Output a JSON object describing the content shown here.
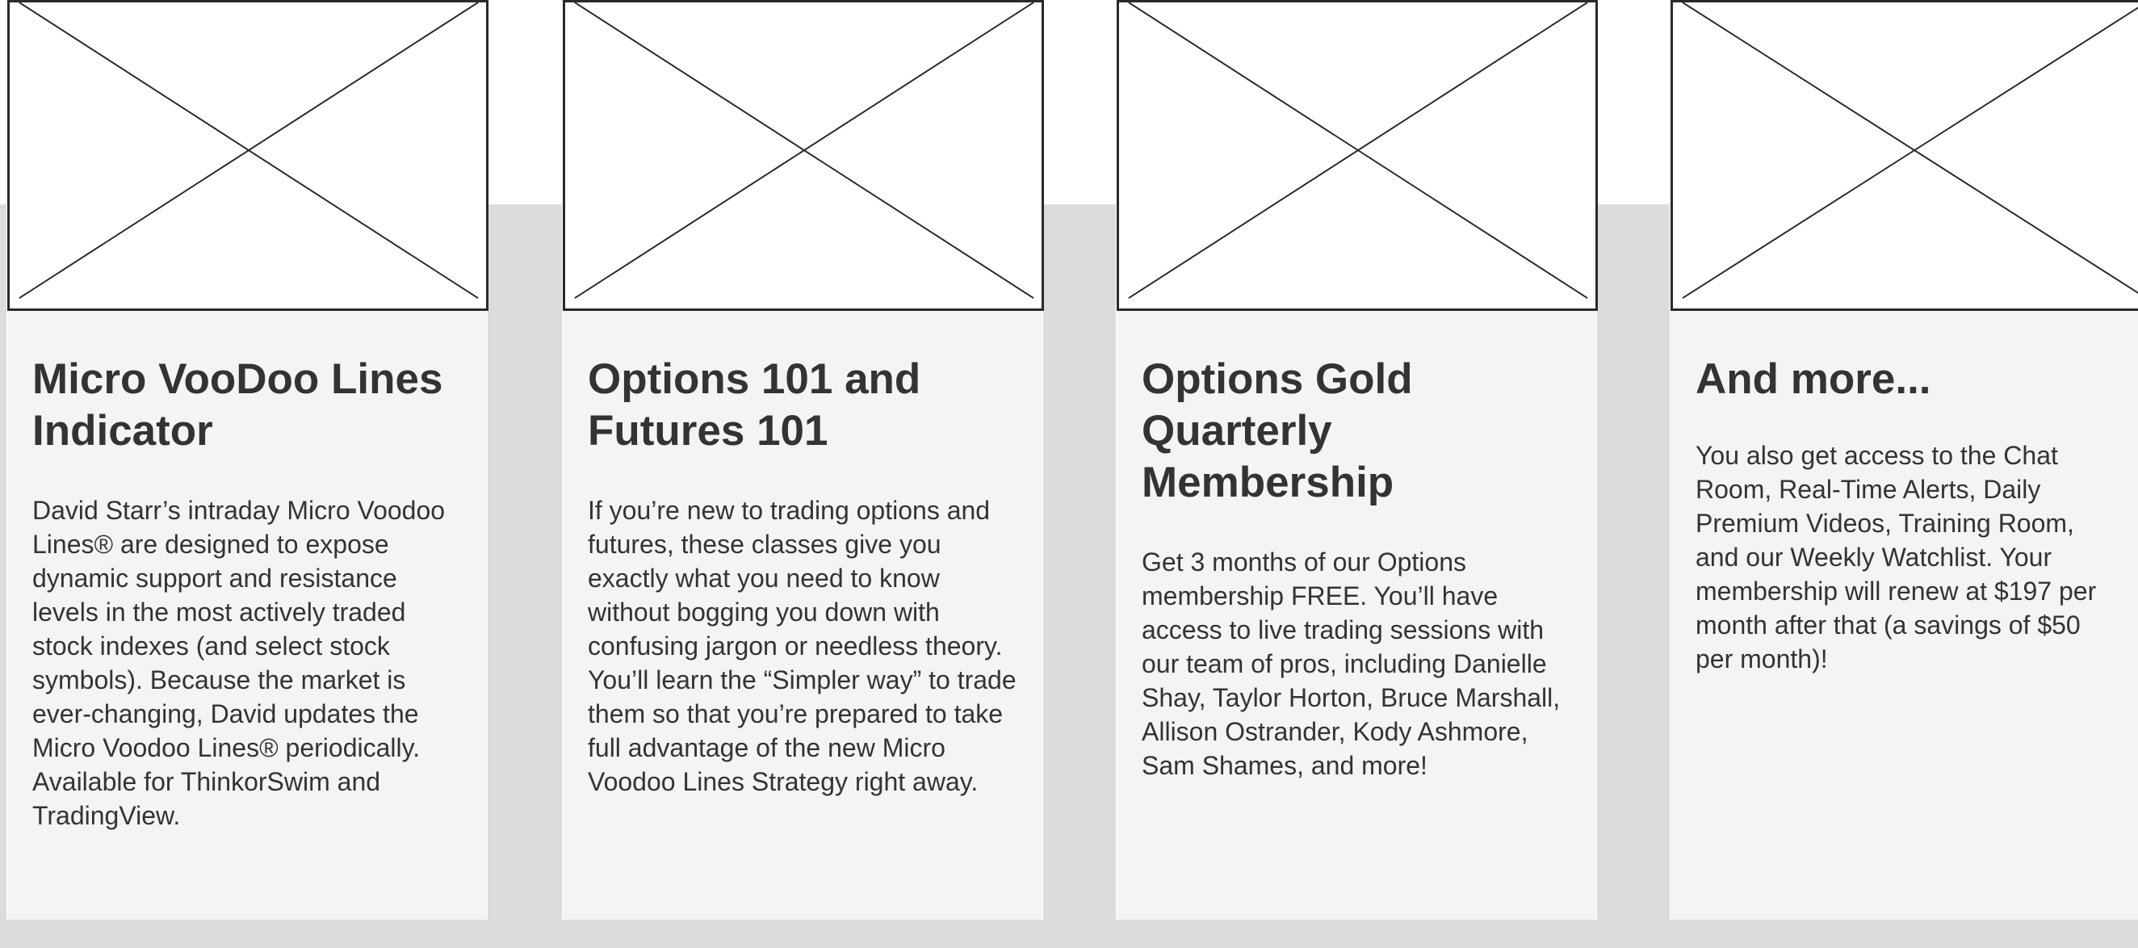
{
  "cards": [
    {
      "title": "Micro VooDoo Lines Indicator",
      "description": "David Starr’s intraday Micro Voodoo Lines® are designed to expose dynamic support and resistance levels in the most actively traded stock indexes (and select stock symbols). Because the market is ever-changing, David updates the Micro Voodoo Lines® periodically. Available for ThinkorSwim and TradingView.",
      "image_icon": "placeholder-image-icon"
    },
    {
      "title": "Options 101 and Futures 101",
      "description": "If you’re new to trading options and futures, these classes give you exactly what you need to know without bogging you down with confusing jargon or needless theory. You’ll learn the “Simpler way” to trade them so that you’re prepared to take full advantage of the new Micro Voodoo Lines Strategy right away.",
      "image_icon": "placeholder-image-icon"
    },
    {
      "title": "Options Gold Quarterly Membership",
      "description": "Get 3 months of our Options membership FREE. You’ll have access to live trading sessions with our team of pros, including Danielle Shay, Taylor Horton, Bruce Marshall, Allison Ostrander, Kody Ashmore, Sam Shames, and more!",
      "image_icon": "placeholder-image-icon"
    },
    {
      "title": "And more...",
      "description": "You also get access to the Chat Room, Real-Time Alerts, Daily Premium Videos, Training Room, and our Weekly Watchlist. Your membership will renew at $197 per month after that (a savings of $50 per month)!",
      "image_icon": "placeholder-image-icon"
    }
  ],
  "colors": {
    "band_background": "#dcdcdc",
    "card_background": "#f4f4f4",
    "text": "#333333",
    "image_border": "#2a2a2a"
  }
}
